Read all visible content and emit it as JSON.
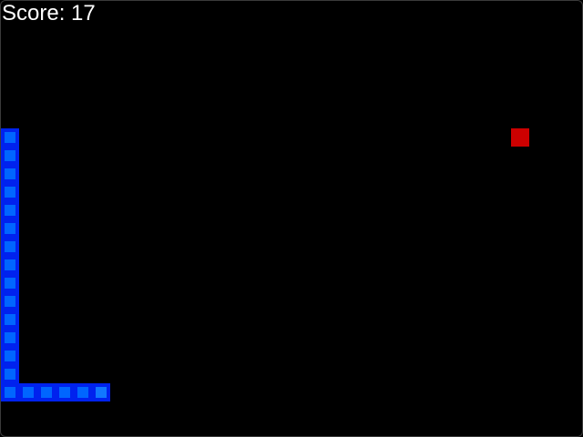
{
  "hud": {
    "score_text": "Score: 17",
    "score_value": 17
  },
  "grid": {
    "cell_units": "grid-cells",
    "columns": 32,
    "rows": 24
  },
  "snake": {
    "body_color": "#0022ee",
    "inner_color": "#0066ff",
    "head_inner_color": "#1177ff",
    "segments": [
      {
        "col": 5,
        "row": 21,
        "head": true
      },
      {
        "col": 4,
        "row": 21
      },
      {
        "col": 3,
        "row": 21
      },
      {
        "col": 2,
        "row": 21
      },
      {
        "col": 1,
        "row": 21
      },
      {
        "col": 0,
        "row": 21
      },
      {
        "col": 0,
        "row": 20
      },
      {
        "col": 0,
        "row": 19
      },
      {
        "col": 0,
        "row": 18
      },
      {
        "col": 0,
        "row": 17
      },
      {
        "col": 0,
        "row": 16
      },
      {
        "col": 0,
        "row": 15
      },
      {
        "col": 0,
        "row": 14
      },
      {
        "col": 0,
        "row": 13
      },
      {
        "col": 0,
        "row": 12
      },
      {
        "col": 0,
        "row": 11
      },
      {
        "col": 0,
        "row": 10
      },
      {
        "col": 0,
        "row": 9
      },
      {
        "col": 0,
        "row": 8
      },
      {
        "col": 0,
        "row": 7
      }
    ]
  },
  "food": {
    "col": 28,
    "row": 7,
    "color": "#cc0000"
  }
}
